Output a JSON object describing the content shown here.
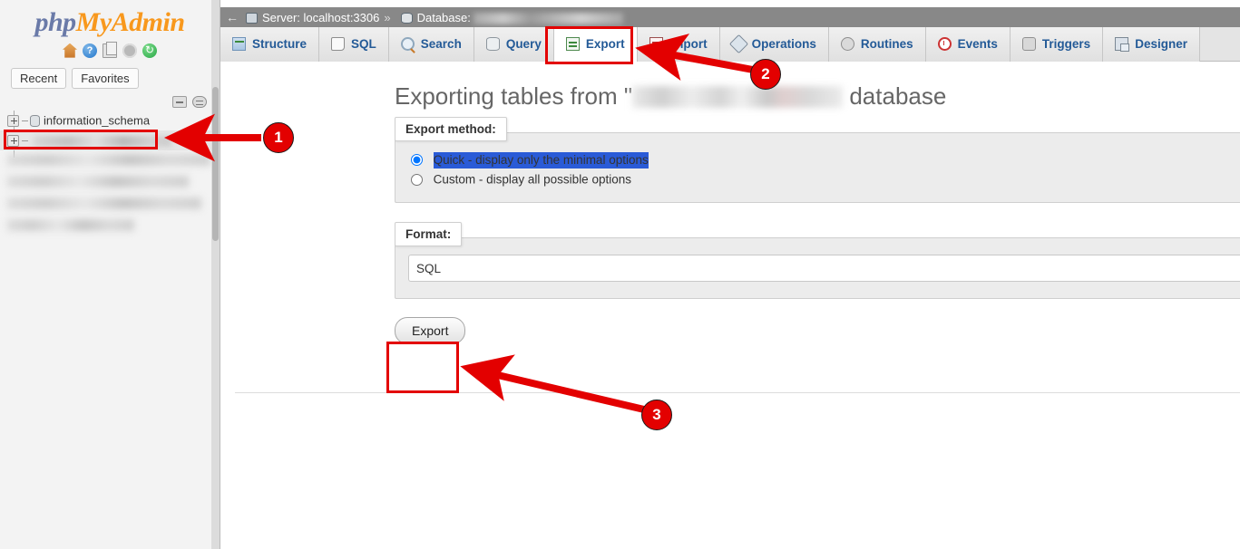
{
  "app": {
    "logo_php": "php",
    "logo_my": "My",
    "logo_admin": "Admin"
  },
  "sidebar": {
    "icons": [
      {
        "name": "home-icon",
        "glyph": ""
      },
      {
        "name": "help-icon",
        "glyph": "?"
      },
      {
        "name": "documentation-icon",
        "glyph": ""
      },
      {
        "name": "settings-gear-icon",
        "glyph": ""
      },
      {
        "name": "reload-icon",
        "glyph": "↻"
      }
    ],
    "quick_links": [
      {
        "label": "Recent",
        "name": "recent-button"
      },
      {
        "label": "Favorites",
        "name": "favorites-button"
      }
    ],
    "tree_tools": [
      {
        "name": "collapse-all-icon"
      },
      {
        "name": "toggle-links-icon"
      }
    ],
    "tree": [
      {
        "label": "information_schema",
        "redacted": false,
        "selected": false
      },
      {
        "label": "",
        "redacted": true,
        "selected": true
      }
    ],
    "redacted_rows": 4
  },
  "server_bar": {
    "back_arrow": "←",
    "server_label": "Server: localhost:3306",
    "separator": "»",
    "database_label": "Database:",
    "database_name_redacted": true
  },
  "tabs": [
    {
      "label": "Structure",
      "icon": "structure-icon",
      "active": false
    },
    {
      "label": "SQL",
      "icon": "sql-icon",
      "active": false
    },
    {
      "label": "Search",
      "icon": "search-icon",
      "active": false
    },
    {
      "label": "Query",
      "icon": "query-icon",
      "active": false
    },
    {
      "label": "Export",
      "icon": "export-icon",
      "active": true
    },
    {
      "label": "Import",
      "icon": "import-icon",
      "active": false
    },
    {
      "label": "Operations",
      "icon": "operations-icon",
      "active": false
    },
    {
      "label": "Routines",
      "icon": "routines-icon",
      "active": false
    },
    {
      "label": "Events",
      "icon": "events-icon",
      "active": false
    },
    {
      "label": "Triggers",
      "icon": "triggers-icon",
      "active": false
    },
    {
      "label": "Designer",
      "icon": "designer-icon",
      "active": false
    }
  ],
  "main": {
    "title_prefix": "Exporting tables from \"",
    "title_suffix": " database",
    "export_method": {
      "legend": "Export method:",
      "options": [
        {
          "label": "Quick - display only the minimal options",
          "checked": true,
          "highlighted": true
        },
        {
          "label": "Custom - display all possible options",
          "checked": false,
          "highlighted": false
        }
      ]
    },
    "format": {
      "legend": "Format:",
      "selected": "SQL",
      "options": [
        "SQL"
      ]
    },
    "export_button": "Export"
  },
  "annotations": [
    {
      "number": "1",
      "target": "sidebar-selected-database"
    },
    {
      "number": "2",
      "target": "export-tab"
    },
    {
      "number": "3",
      "target": "export-button"
    }
  ],
  "colors": {
    "annotation_red": "#e30000",
    "server_bar_gray": "#888888",
    "tab_link_blue": "#235a97",
    "selection_blue": "#2a5bd7",
    "logo_orange": "#f8981d",
    "logo_blue": "#6a7aa8"
  }
}
